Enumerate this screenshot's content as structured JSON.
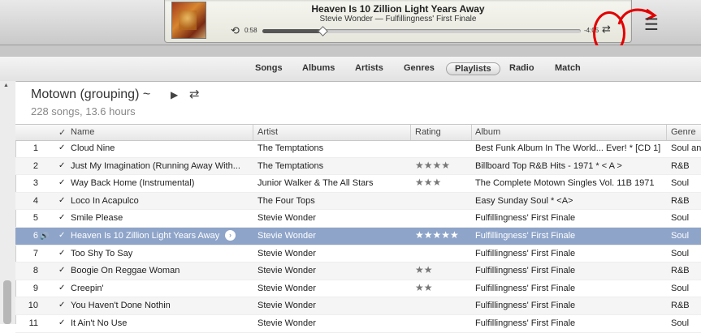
{
  "now_playing": {
    "title": "Heaven Is 10 Zillion Light Years Away",
    "subtitle": "Stevie Wonder — Fulfillingness' First Finale",
    "elapsed": "0:58",
    "remaining": "-4:05",
    "progress_fraction": 0.19
  },
  "tabs": [
    "Songs",
    "Albums",
    "Artists",
    "Genres",
    "Playlists",
    "Radio",
    "Match"
  ],
  "active_tab": "Playlists",
  "playlist": {
    "title": "Motown (grouping) ~",
    "summary": "228 songs, 13.6 hours"
  },
  "columns": {
    "check": "✓",
    "name": "Name",
    "artist": "Artist",
    "rating": "Rating",
    "album": "Album",
    "genre": "Genre"
  },
  "rows": [
    {
      "num": "1",
      "name": "Cloud Nine",
      "artist": "The Temptations",
      "rating": "",
      "album": "Best Funk Album In The World... Ever! * [CD 1]",
      "genre": "Soul and"
    },
    {
      "num": "2",
      "name": "Just My Imagination (Running Away With...",
      "artist": "The Temptations",
      "rating": "★★★★",
      "album": "Billboard Top R&B Hits - 1971 * < A >",
      "genre": "R&B"
    },
    {
      "num": "3",
      "name": "Way Back Home (Instrumental)",
      "artist": "Junior Walker & The All Stars",
      "rating": "★★★",
      "album": "The Complete Motown Singles Vol. 11B 1971",
      "genre": "Soul"
    },
    {
      "num": "4",
      "name": "Loco In Acapulco",
      "artist": "The Four Tops",
      "rating": "",
      "album": "Easy Sunday Soul * <A>",
      "genre": "R&B"
    },
    {
      "num": "5",
      "name": "Smile Please",
      "artist": "Stevie Wonder",
      "rating": "",
      "album": "Fulfillingness' First Finale",
      "genre": "Soul"
    },
    {
      "num": "6",
      "name": "Heaven Is 10 Zillion Light Years Away",
      "artist": "Stevie Wonder",
      "rating": "★★★★★",
      "album": "Fulfillingness' First Finale",
      "genre": "Soul",
      "selected": true
    },
    {
      "num": "7",
      "name": "Too Shy To Say",
      "artist": "Stevie Wonder",
      "rating": "",
      "album": "Fulfillingness' First Finale",
      "genre": "Soul"
    },
    {
      "num": "8",
      "name": "Boogie On Reggae Woman",
      "artist": "Stevie Wonder",
      "rating": "★★",
      "album": "Fulfillingness' First Finale",
      "genre": "R&B"
    },
    {
      "num": "9",
      "name": "Creepin'",
      "artist": "Stevie Wonder",
      "rating": "★★",
      "album": "Fulfillingness' First Finale",
      "genre": "Soul"
    },
    {
      "num": "10",
      "name": "You Haven't Done Nothin",
      "artist": "Stevie Wonder",
      "rating": "",
      "album": "Fulfillingness' First Finale",
      "genre": "R&B"
    },
    {
      "num": "11",
      "name": "It Ain't No Use",
      "artist": "Stevie Wonder",
      "rating": "",
      "album": "Fulfillingness' First Finale",
      "genre": "Soul"
    }
  ],
  "icons": {
    "repeat": "repeat-icon",
    "shuffle": "shuffle-icon",
    "list": "up-next-list-icon",
    "play": "play-icon",
    "speaker": "speaker-icon",
    "go": "chevron-right-circle-icon"
  },
  "annotation_color": "#e20000",
  "selection_color": "#8ea4c9"
}
